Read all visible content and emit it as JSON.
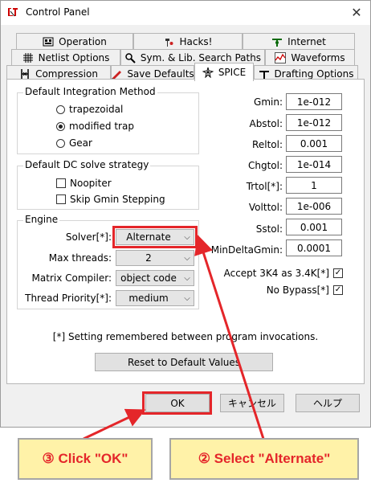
{
  "window": {
    "title": "Control Panel",
    "close_glyph": "✕"
  },
  "tabs": {
    "row1": [
      {
        "label": "Operation",
        "icon": "operation-icon"
      },
      {
        "label": "Hacks!",
        "icon": "hacks-icon"
      },
      {
        "label": "Internet",
        "icon": "internet-icon"
      }
    ],
    "row2": [
      {
        "label": "Netlist Options",
        "icon": "netlist-icon"
      },
      {
        "label": "Sym. & Lib. Search Paths",
        "icon": "search-icon"
      },
      {
        "label": "Waveforms",
        "icon": "waveform-icon"
      }
    ],
    "row3": [
      {
        "label": "Compression",
        "icon": "compression-icon"
      },
      {
        "label": "Save Defaults",
        "icon": "save-icon"
      },
      {
        "label": "SPICE",
        "icon": "spice-icon",
        "active": true
      },
      {
        "label": "Drafting Options",
        "icon": "drafting-icon"
      }
    ]
  },
  "integration": {
    "legend": "Default Integration Method",
    "options": [
      "trapezoidal",
      "modified trap",
      "Gear"
    ],
    "selected": "modified trap"
  },
  "dc": {
    "legend": "Default DC solve strategy",
    "noopiter": "Noopiter",
    "skip_gmin": "Skip Gmin Stepping"
  },
  "engine": {
    "legend": "Engine",
    "solver_label": "Solver[*]:",
    "solver_value": "Alternate",
    "threads_label": "Max threads:",
    "threads_value": "2",
    "compiler_label": "Matrix Compiler:",
    "compiler_value": "object code",
    "priority_label": "Thread Priority[*]:",
    "priority_value": "medium"
  },
  "tolerances": [
    {
      "label": "Gmin:",
      "value": "1e-012"
    },
    {
      "label": "Abstol:",
      "value": "1e-012"
    },
    {
      "label": "Reltol:",
      "value": "0.001"
    },
    {
      "label": "Chgtol:",
      "value": "1e-014"
    },
    {
      "label": "Trtol[*]:",
      "value": "1"
    },
    {
      "label": "Volttol:",
      "value": "1e-006"
    },
    {
      "label": "Sstol:",
      "value": "0.001"
    },
    {
      "label": "MinDeltaGmin:",
      "value": "0.0001"
    }
  ],
  "checks": {
    "accept3k4": "Accept 3K4 as 3.4K[*]",
    "no_bypass": "No Bypass[*]",
    "check_glyph": "✓"
  },
  "note": "[*] Setting remembered between program invocations.",
  "buttons": {
    "reset": "Reset to Default Values",
    "ok": "OK",
    "cancel": "キャンセル",
    "help": "ヘルプ"
  },
  "callouts": {
    "click_ok": "③ Click \"OK\"",
    "select_alternate": "② Select \"Alternate\""
  },
  "colors": {
    "highlight": "#e4262a",
    "callout_bg": "#fff2a8"
  }
}
